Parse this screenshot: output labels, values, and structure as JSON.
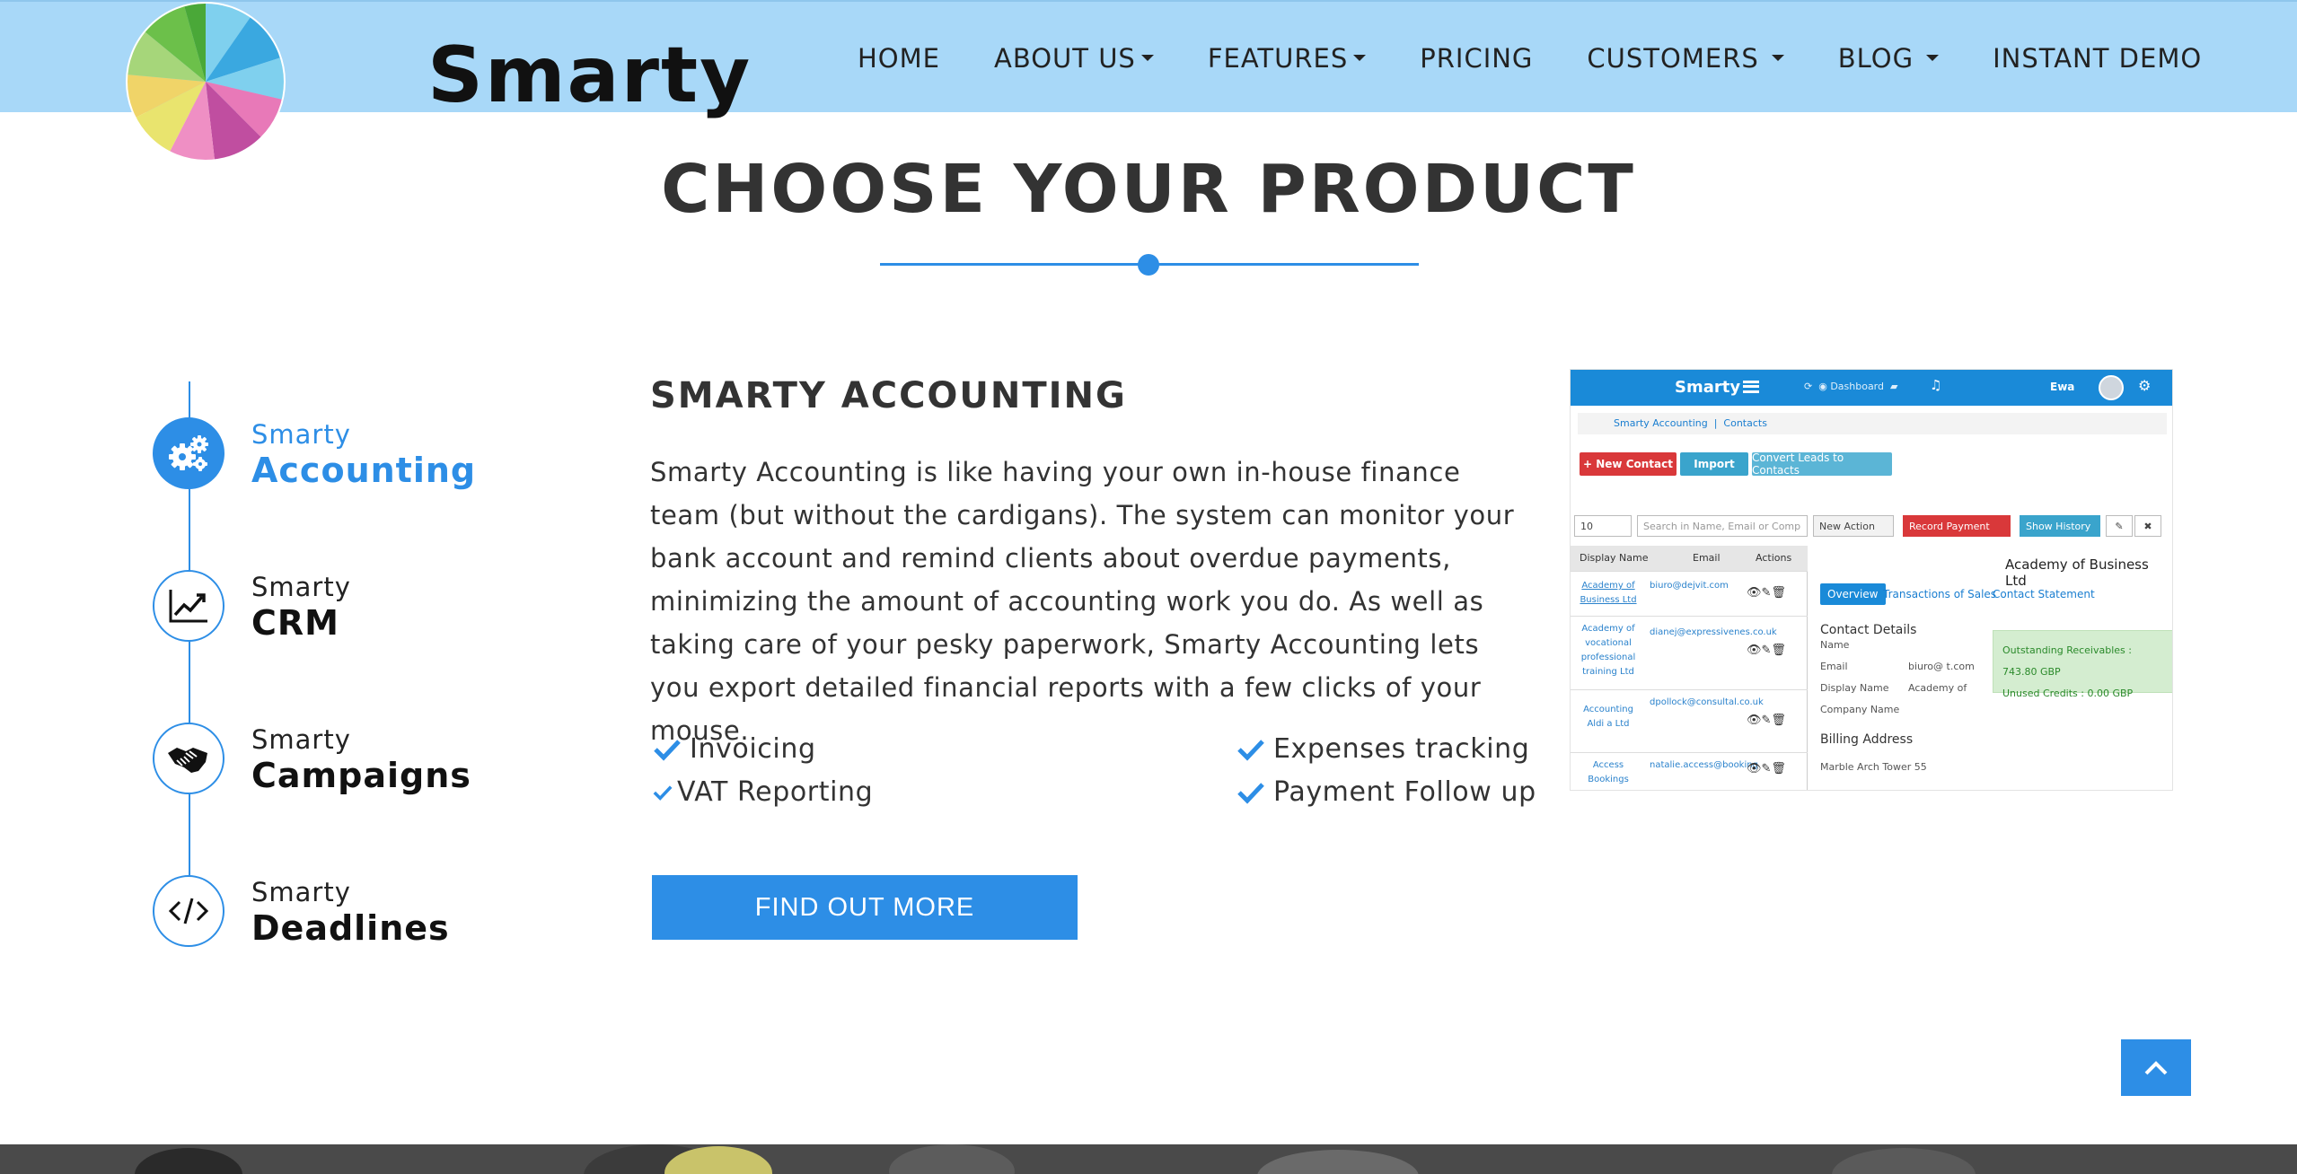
{
  "nav": {
    "brand": "Smarty",
    "items": [
      {
        "label": "HOME"
      },
      {
        "label": "ABOUT US"
      },
      {
        "label": "FEATURES"
      },
      {
        "label": "PRICING"
      },
      {
        "label": "CUSTOMERS"
      },
      {
        "label": "BLOG"
      },
      {
        "label": "INSTANT DEMO"
      }
    ]
  },
  "section": {
    "title": "CHOOSE YOUR PRODUCT"
  },
  "products": [
    {
      "prefix": "Smarty",
      "name": "Accounting",
      "icon": "gears-icon",
      "active": true
    },
    {
      "prefix": "Smarty",
      "name": "CRM",
      "icon": "chart-trend-icon",
      "active": false
    },
    {
      "prefix": "Smarty",
      "name": "Campaigns",
      "icon": "handshake-icon",
      "active": false
    },
    {
      "prefix": "Smarty",
      "name": "Deadlines",
      "icon": "code-icon",
      "active": false
    }
  ],
  "detail": {
    "title": "SMARTY ACCOUNTING",
    "description": "Smarty Accounting is like having your own in-house finance team (but without the cardigans). The system can monitor your bank account and remind clients about overdue payments, minimizing the amount of accounting work you do. As well as taking care of your pesky paperwork, Smarty Accounting lets you export detailed financial reports with a few clicks of your mouse.",
    "features": [
      "Invoicing",
      "Expenses tracking",
      "VAT Reporting",
      "Payment Follow up"
    ],
    "button": "FIND OUT MORE"
  },
  "screenshot": {
    "brand": "Smarty",
    "dashboard": "Dashboard",
    "user": "Ewa",
    "breadcrumb": [
      "Smarty Accounting",
      "Contacts"
    ],
    "buttons": [
      "+ New Contact",
      "Import",
      "Convert Leads to Contacts"
    ],
    "page_size": "10",
    "search_placeholder": "Search in Name, Email or Comp",
    "new_action": "New Action",
    "record_payment": "Record Payment",
    "show_history": "Show History",
    "columns": [
      "Display Name",
      "Email",
      "Actions"
    ],
    "rows": [
      {
        "name": "Academy of Business Ltd",
        "email": "biuro@dejvit.com"
      },
      {
        "name": "Academy of vocational professional training Ltd",
        "email": "dianej@expressivenes.co.uk"
      },
      {
        "name": "Accounting Aldi a Ltd",
        "email": "dpollock@consultal.co.uk"
      },
      {
        "name": "Access Bookings",
        "email": "natalie.access@booking"
      }
    ],
    "detail_title": "Academy of Business Ltd",
    "tabs": [
      "Overview",
      "Transactions of Sales",
      "Contact Statement"
    ],
    "contact_details": "Contact Details",
    "labels": [
      "Name",
      "Email",
      "Display Name",
      "Company Name"
    ],
    "email_value": "biuro@        t.com",
    "display_value": "Academy of",
    "outstanding": "Outstanding Receivables : 743.80 GBP",
    "unused": "Unused Credits : 0.00 GBP",
    "billing": "Billing Address",
    "billing_line": "Marble Arch Tower 55"
  },
  "colors": {
    "accent": "#2d8ee6",
    "nav_bg": "#a8d8f8",
    "text": "#333333"
  }
}
